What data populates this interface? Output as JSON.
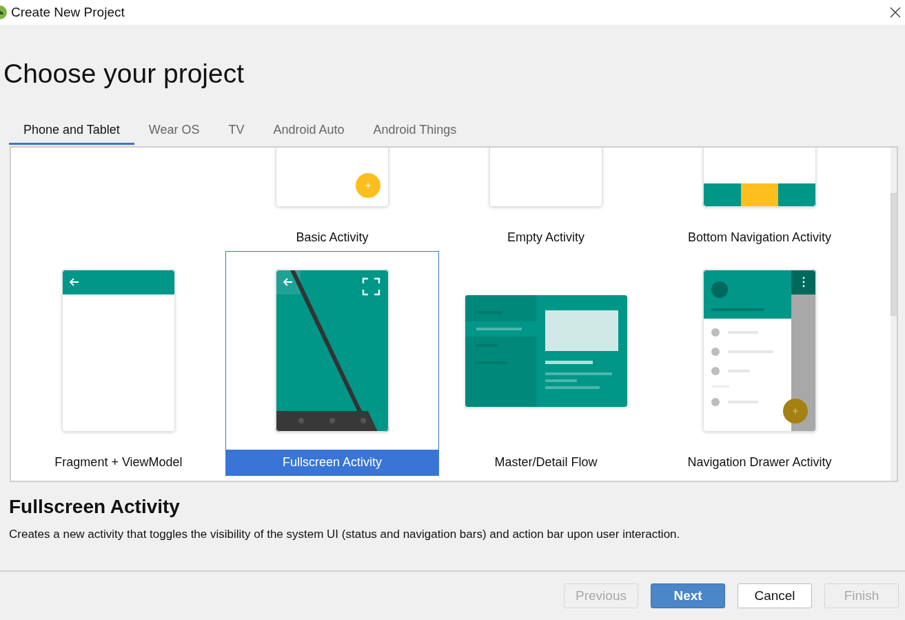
{
  "window": {
    "title": "Create New Project"
  },
  "heading": "Choose your project",
  "tabs": [
    {
      "label": "Phone and Tablet",
      "selected": true
    },
    {
      "label": "Wear OS",
      "selected": false
    },
    {
      "label": "TV",
      "selected": false
    },
    {
      "label": "Android Auto",
      "selected": false
    },
    {
      "label": "Android Things",
      "selected": false
    }
  ],
  "templates": [
    {
      "label": "Basic Activity",
      "kind": "basic",
      "selected": false
    },
    {
      "label": "Empty Activity",
      "kind": "empty",
      "selected": false
    },
    {
      "label": "Bottom Navigation Activity",
      "kind": "bottom-nav",
      "selected": false
    },
    {
      "label": "Fragment + ViewModel",
      "kind": "fragment",
      "selected": false
    },
    {
      "label": "Fullscreen Activity",
      "kind": "fullscreen",
      "selected": true
    },
    {
      "label": "Master/Detail Flow",
      "kind": "master-detail",
      "selected": false
    },
    {
      "label": "Navigation Drawer Activity",
      "kind": "nav-drawer",
      "selected": false
    }
  ],
  "description": {
    "title": "Fullscreen Activity",
    "text": "Creates a new activity that toggles the visibility of the system UI (status and navigation bars) and action bar upon user interaction."
  },
  "buttons": [
    {
      "label": "Previous",
      "kind": "default",
      "disabled": true
    },
    {
      "label": "Next",
      "kind": "primary",
      "disabled": false
    },
    {
      "label": "Cancel",
      "kind": "default",
      "disabled": false
    },
    {
      "label": "Finish",
      "kind": "default",
      "disabled": true
    }
  ]
}
